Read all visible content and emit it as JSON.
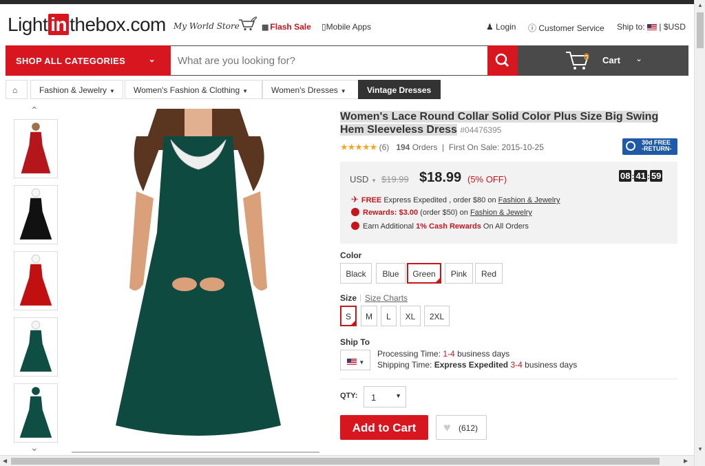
{
  "header": {
    "logo_prefix": "Light",
    "logo_in": "in",
    "logo_suffix": "thebox.com",
    "tagline": "My World Store",
    "flash_sale": "Flash Sale",
    "mobile_apps": "Mobile Apps",
    "login": "Login",
    "customer_service": "Customer Service",
    "ship_to": "Ship to:",
    "currency": "$USD"
  },
  "searchbar": {
    "shop_all": "SHOP ALL CATEGORIES",
    "placeholder": "What are you looking for?",
    "cart_count": "0",
    "cart_label": "Cart"
  },
  "breadcrumbs": [
    "Fashion & Jewelry",
    "Women's Fashion & Clothing",
    "Women's Dresses",
    "Vintage Dresses"
  ],
  "product": {
    "title": "Women's Lace Round Collar Solid Color Plus Size Big Swing Hem Sleeveless Dress",
    "sku": "#04476395",
    "rating_count": "(6)",
    "orders_count": "194",
    "orders_label": "Orders",
    "first_on_sale": "First On Sale: 2015-10-25",
    "return_badge_line1": "30d FREE",
    "return_badge_line2": "-RETURN-",
    "currency": "USD",
    "old_price": "$19.99",
    "price": "$18.99",
    "discount": "(5% OFF)",
    "timer": [
      "08",
      "41",
      "59"
    ],
    "promo1_free": "FREE",
    "promo1_text": "Express Expedited , order $80 on",
    "promo1_link": "Fashion & Jewelry",
    "promo2_rewards": "Rewards: $3.00",
    "promo2_text": "(order $50) on",
    "promo2_link": "Fashion & Jewelry",
    "promo3_text": "Earn Additional",
    "promo3_red": "1% Cash Rewards",
    "promo3_end": "On All Orders",
    "color_label": "Color",
    "colors": [
      "Black",
      "Blue",
      "Green",
      "Pink",
      "Red"
    ],
    "selected_color": "Green",
    "size_label": "Size",
    "size_chart": "Size Charts",
    "sizes": [
      "S",
      "M",
      "L",
      "XL",
      "2XL"
    ],
    "selected_size": "S",
    "ship_to_label": "Ship To",
    "processing_label": "Processing Time:",
    "processing_range": "1-4",
    "processing_unit": "business days",
    "shipping_label": "Shipping Time:",
    "shipping_method": "Express Expedited",
    "shipping_range": "3-4",
    "shipping_unit": "business days",
    "qty_label": "QTY:",
    "qty_value": "1",
    "add_to_cart": "Add to Cart",
    "wishlist_count": "(612)"
  },
  "thumbnail_colors": [
    "#b5161b",
    "#111111",
    "#c01010",
    "#0f4f43",
    "#0f4f43"
  ],
  "main_image_color": "#0e4a40"
}
